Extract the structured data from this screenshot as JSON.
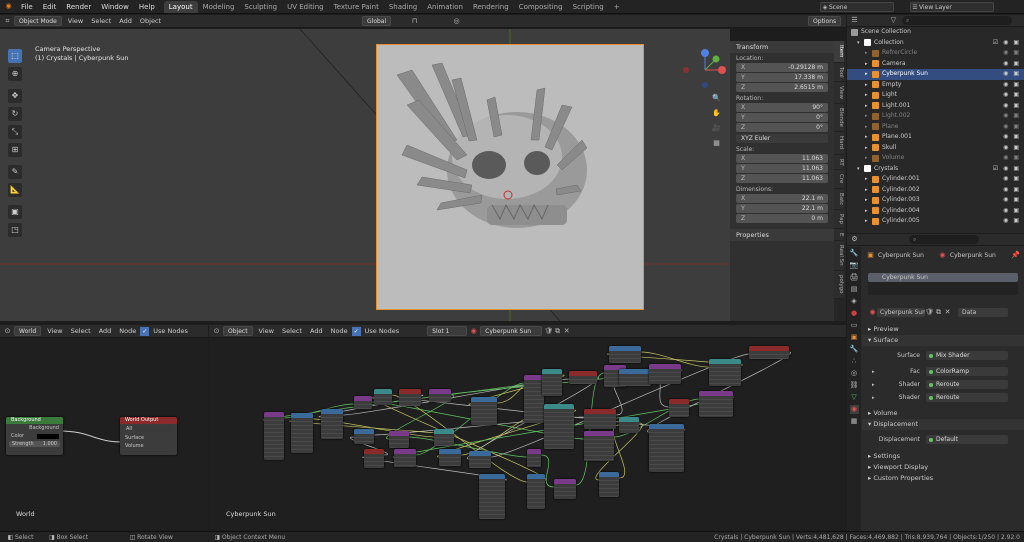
{
  "topbar": {
    "menus": [
      "File",
      "Edit",
      "Render",
      "Window",
      "Help"
    ],
    "workspaces": [
      "Layout",
      "Modeling",
      "Sculpting",
      "UV Editing",
      "Texture Paint",
      "Shading",
      "Animation",
      "Rendering",
      "Compositing",
      "Scripting"
    ],
    "active_workspace": "Layout",
    "scene": "Scene",
    "view_layer": "View Layer"
  },
  "viewport": {
    "mode": "Object Mode",
    "menus": [
      "View",
      "Select",
      "Add",
      "Object"
    ],
    "orientation": "Global",
    "overlay_title": "Camera Perspective",
    "overlay_subtitle": "(1) Crystals | Cyberpunk Sun",
    "options": "Options"
  },
  "npanel": {
    "transform_title": "Transform",
    "location_label": "Location:",
    "location": [
      {
        "k": "X",
        "v": "-0.29128 m"
      },
      {
        "k": "Y",
        "v": "17.338 m"
      },
      {
        "k": "Z",
        "v": "2.6515 m"
      }
    ],
    "rotation_label": "Rotation:",
    "rotation": [
      {
        "k": "X",
        "v": "90°"
      },
      {
        "k": "Y",
        "v": "0°"
      },
      {
        "k": "Z",
        "v": "0°"
      }
    ],
    "rotation_mode": "XYZ Euler",
    "scale_label": "Scale:",
    "scale": [
      {
        "k": "X",
        "v": "11.063"
      },
      {
        "k": "Y",
        "v": "11.063"
      },
      {
        "k": "Z",
        "v": "11.063"
      }
    ],
    "dimensions_label": "Dimensions:",
    "dimensions": [
      {
        "k": "X",
        "v": "22.1 m"
      },
      {
        "k": "Y",
        "v": "22.1 m"
      },
      {
        "k": "Z",
        "v": "0 m"
      }
    ],
    "properties_title": "Properties",
    "tabs": [
      "Item",
      "Tool",
      "View",
      "Blende",
      "Hard",
      "RT",
      "Cre",
      "Batc",
      "Pap",
      "E",
      "Real Sn",
      "polygo"
    ]
  },
  "outliner": {
    "title": "Scene Collection",
    "rows": [
      {
        "label": "Collection",
        "level": 1,
        "type": "collection"
      },
      {
        "label": "RefrerCircle",
        "level": 2,
        "type": "empty",
        "dim": true
      },
      {
        "label": "Camera",
        "level": 2,
        "type": "camera"
      },
      {
        "label": "Cyberpunk Sun",
        "level": 2,
        "type": "mesh",
        "selected": true
      },
      {
        "label": "Empty",
        "level": 2,
        "type": "empty"
      },
      {
        "label": "Light",
        "level": 2,
        "type": "light"
      },
      {
        "label": "Light.001",
        "level": 2,
        "type": "light"
      },
      {
        "label": "Light.002",
        "level": 2,
        "type": "light",
        "dim": true
      },
      {
        "label": "Plane",
        "level": 2,
        "type": "mesh",
        "dim": true
      },
      {
        "label": "Plane.001",
        "level": 2,
        "type": "mesh"
      },
      {
        "label": "Skull",
        "level": 2,
        "type": "mesh"
      },
      {
        "label": "Volume",
        "level": 2,
        "type": "mesh",
        "dim": true
      },
      {
        "label": "Crystals",
        "level": 1,
        "type": "collection"
      },
      {
        "label": "Cylinder.001",
        "level": 2,
        "type": "mesh"
      },
      {
        "label": "Cylinder.002",
        "level": 2,
        "type": "mesh"
      },
      {
        "label": "Cylinder.003",
        "level": 2,
        "type": "mesh"
      },
      {
        "label": "Cylinder.004",
        "level": 2,
        "type": "mesh"
      },
      {
        "label": "Cylinder.005",
        "level": 2,
        "type": "mesh"
      }
    ]
  },
  "properties": {
    "breadcrumb_left": "Cyberpunk Sun",
    "breadcrumb_right": "Cyberpunk Sun",
    "material_slot": "Cyberpunk Sun",
    "material_name": "Cyberpunk Sun",
    "data_dropdown": "Data",
    "sections": {
      "preview": "Preview",
      "surface": "Surface",
      "volume": "Volume",
      "displacement": "Displacement",
      "settings": "Settings",
      "viewport_display": "Viewport Display",
      "custom_properties": "Custom Properties"
    },
    "surface_label": "Surface",
    "surface_value": "Mix Shader",
    "inputs": [
      {
        "label": "Fac",
        "value": "ColorRamp"
      },
      {
        "label": "Shader",
        "value": "Reroute"
      },
      {
        "label": "Shader",
        "value": "Reroute"
      }
    ],
    "displacement_label": "Displacement",
    "displacement_value": "Default"
  },
  "world_editor": {
    "type": "World",
    "menus": [
      "View",
      "Select",
      "Add",
      "Node"
    ],
    "use_nodes": "Use Nodes",
    "label": "World",
    "bg_node": {
      "title": "Background",
      "out": "Background",
      "color": "Color",
      "strength_label": "Strength",
      "strength": "1.000"
    },
    "out_node": {
      "title": "World Output",
      "target": "All",
      "surface": "Surface",
      "volume": "Volume"
    }
  },
  "shader_editor": {
    "type": "Object",
    "menus": [
      "View",
      "Select",
      "Add",
      "Node"
    ],
    "use_nodes": "Use Nodes",
    "slot": "Slot 1",
    "material": "Cyberpunk Sun",
    "label": "Cyberpunk Sun"
  },
  "statusbar": {
    "items": [
      "Select",
      "Box Select",
      "Rotate View",
      "Object Context Menu"
    ],
    "stats": "Crystals | Cyberpunk Sun | Verts:4,481,628 | Faces:4,469,882 | Tris:8,939,764 | Objects:1/250 | 2.92.0"
  },
  "colors": {
    "accent": "#4772b3",
    "selection": "#334d80",
    "camera_border": "#e8922e",
    "node_input_green": "#63c763"
  }
}
